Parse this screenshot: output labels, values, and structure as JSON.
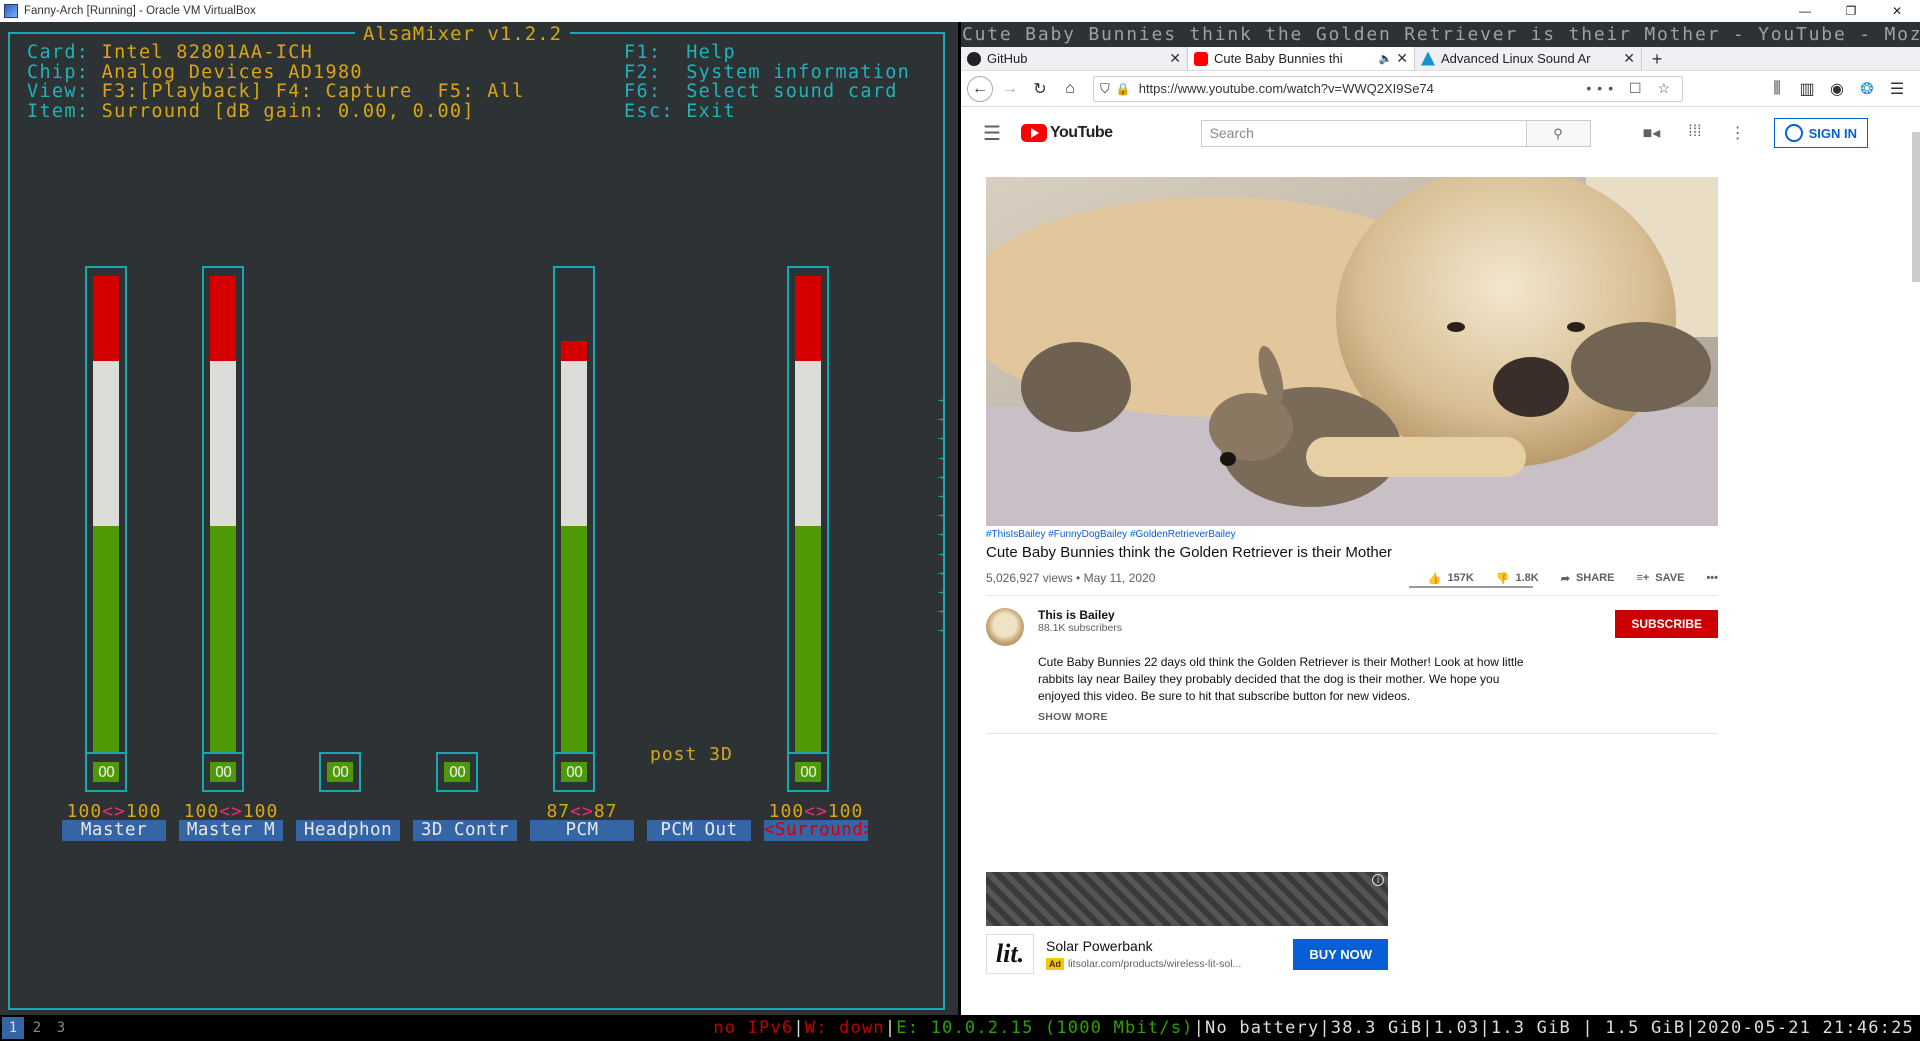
{
  "vbox": {
    "title": "Fanny-Arch [Running] - Oracle VM VirtualBox",
    "controls": [
      "—",
      "❐",
      "✕"
    ]
  },
  "alsamixer": {
    "title": "AlsaMixer v1.2.2",
    "card_label": "Card:",
    "card": "Intel 82801AA-ICH",
    "chip_label": "Chip:",
    "chip": "Analog Devices AD1980",
    "view_label": "View:",
    "view": "F3:[Playback] F4: Capture  F5: All",
    "item_label": "Item:",
    "item": "Surround [dB gain: 0.00, 0.00]",
    "keys": [
      {
        "key": "F1:",
        "label": "Help"
      },
      {
        "key": "F2:",
        "label": "System information"
      },
      {
        "key": "F6:",
        "label": "Select sound card"
      },
      {
        "key": "Esc:",
        "label": "Exit"
      }
    ],
    "post3d_label": "post 3D",
    "channels": [
      {
        "name": "Master",
        "level_left": "100",
        "level_right": "100",
        "percent": 100,
        "has_bar": true,
        "mute": "OO",
        "selected": false
      },
      {
        "name": "Master M",
        "level_left": "100",
        "level_right": "100",
        "percent": 100,
        "has_bar": true,
        "mute": "OO",
        "selected": false
      },
      {
        "name": "Headphon",
        "level_left": "",
        "level_right": "",
        "percent": 0,
        "has_bar": false,
        "mute": "OO",
        "selected": false
      },
      {
        "name": "3D Contr",
        "level_left": "",
        "level_right": "",
        "percent": 0,
        "has_bar": false,
        "mute": "OO",
        "selected": false
      },
      {
        "name": "PCM",
        "level_left": "87",
        "level_right": "87",
        "percent": 87,
        "has_bar": true,
        "mute": "OO",
        "selected": false
      },
      {
        "name": "PCM Out",
        "level_left": "",
        "level_right": "",
        "percent": 0,
        "has_bar": false,
        "mute": "",
        "selected": false
      },
      {
        "name": "Surround",
        "level_left": "100",
        "level_right": "100",
        "percent": 100,
        "has_bar": true,
        "mute": "OO",
        "selected": true
      }
    ],
    "level_separator": "<>",
    "colors": {
      "red": "#d40000",
      "white": "#dcdcd8",
      "green": "#4e9a06",
      "frame": "#19a8b0",
      "yellow": "#d9a514"
    }
  },
  "browser": {
    "window_title": "Cute Baby Bunnies think the Golden Retriever is their Mother - YouTube - Mozilla Firefox",
    "tabs": [
      {
        "label": "GitHub",
        "icon": "github-icon",
        "active": false
      },
      {
        "label": "Cute Baby Bunnies thi",
        "icon": "youtube-icon",
        "active": true,
        "muted_icon": "speaker-icon"
      },
      {
        "label": "Advanced Linux Sound Ar",
        "icon": "arch-icon",
        "active": false
      }
    ],
    "new_tab": "+",
    "url": "https://www.youtube.com/watch?v=WWQ2XI9Se74",
    "url_icons": "••• ☐ ☆"
  },
  "youtube": {
    "logo": "YouTube",
    "search_placeholder": "Search",
    "signin": "SIGN IN",
    "hashtags": "#ThisIsBailey #FunnyDogBailey #GoldenRetrieverBailey",
    "title": "Cute Baby Bunnies think the Golden Retriever is their Mother",
    "views_date": "5,026,927 views • May 11, 2020",
    "likes": "157K",
    "dislikes": "1.8K",
    "share": "SHARE",
    "save": "SAVE",
    "channel_name": "This is Bailey",
    "subscribers": "88.1K subscribers",
    "subscribe": "SUBSCRIBE",
    "description": "Cute Baby Bunnies 22 days old think the Golden Retriever is their Mother! Look at how little rabbits lay near Bailey they probably decided that the dog is their mother. We hope you enjoyed this video. Be sure to hit that subscribe button for new videos.",
    "show_more": "SHOW MORE",
    "ad_logo": "lit.",
    "ad_title": "Solar Powerbank",
    "ad_badge": "Ad",
    "ad_url": "litsolar.com/products/wireless-lit-sol...",
    "buy_now": "BUY NOW"
  },
  "statusbar": {
    "workspaces": [
      "1",
      "2",
      "3"
    ],
    "ipv6": "no IPv6",
    "sep1": "|",
    "wifi": "W: down",
    "sep2": "|",
    "eth": "E: 10.0.2.15 (1000 Mbit/s)",
    "rest": "|No battery|38.3 GiB|1.03|1.3 GiB | 1.5 GiB|2020-05-21 21:46:25"
  }
}
